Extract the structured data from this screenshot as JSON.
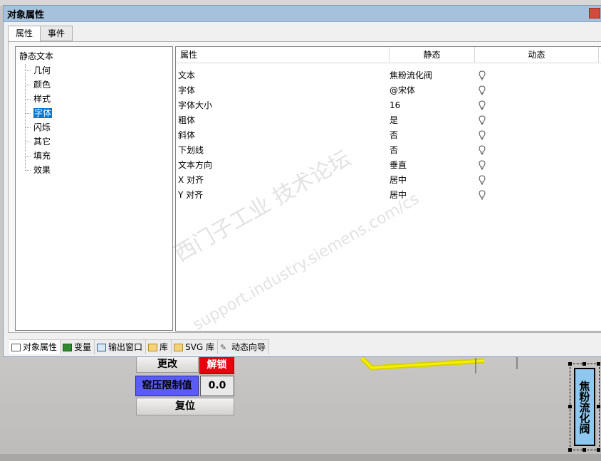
{
  "dialog": {
    "title": "对象属性",
    "tabs": [
      {
        "label": "属性",
        "active": true
      },
      {
        "label": "事件",
        "active": false
      }
    ]
  },
  "tree": {
    "root": "静态文本",
    "items": [
      {
        "label": "几何"
      },
      {
        "label": "颜色"
      },
      {
        "label": "样式"
      },
      {
        "label": "字体",
        "selected": true
      },
      {
        "label": "闪烁"
      },
      {
        "label": "其它"
      },
      {
        "label": "填充"
      },
      {
        "label": "效果"
      }
    ]
  },
  "grid": {
    "headers": {
      "property": "属性",
      "static": "静态",
      "dynamic": "动态"
    },
    "rows": [
      {
        "property": "文本",
        "static": "焦粉流化阀"
      },
      {
        "property": "字体",
        "static": "@宋体"
      },
      {
        "property": "字体大小",
        "static": "16"
      },
      {
        "property": "粗体",
        "static": "是"
      },
      {
        "property": "斜体",
        "static": "否"
      },
      {
        "property": "下划线",
        "static": "否"
      },
      {
        "property": "文本方向",
        "static": "垂直"
      },
      {
        "property": "X 对齐",
        "static": "居中"
      },
      {
        "property": "Y 对齐",
        "static": "居中"
      }
    ]
  },
  "watermark": {
    "line1": "西门子工业 技术论坛",
    "line2": "support.industry.siemens.com/cs"
  },
  "bottom_tabs": [
    {
      "label": "对象属性",
      "icon": "properties-icon",
      "active": true
    },
    {
      "label": "变量",
      "icon": "tag-icon"
    },
    {
      "label": "输出窗口",
      "icon": "output-window-icon"
    },
    {
      "label": "库",
      "icon": "folder-icon"
    },
    {
      "label": "SVG 库",
      "icon": "folder-icon"
    },
    {
      "label": "动态向导",
      "icon": "wand-icon"
    }
  ],
  "hmi": {
    "change_label": "更改",
    "unlock_label": "解锁",
    "limit_label": "窑压限制值",
    "limit_value": "0.0",
    "reset_label": "复位",
    "valve_text": "焦粉流化阀"
  },
  "colors": {
    "titlebar": "#a6c1dc",
    "selection": "#0078d7",
    "unlock_red": "#e8000e",
    "label_blue": "#5b5bf7",
    "valve_fill": "#8ec8f0",
    "pipe_yellow": "#e8e000"
  }
}
